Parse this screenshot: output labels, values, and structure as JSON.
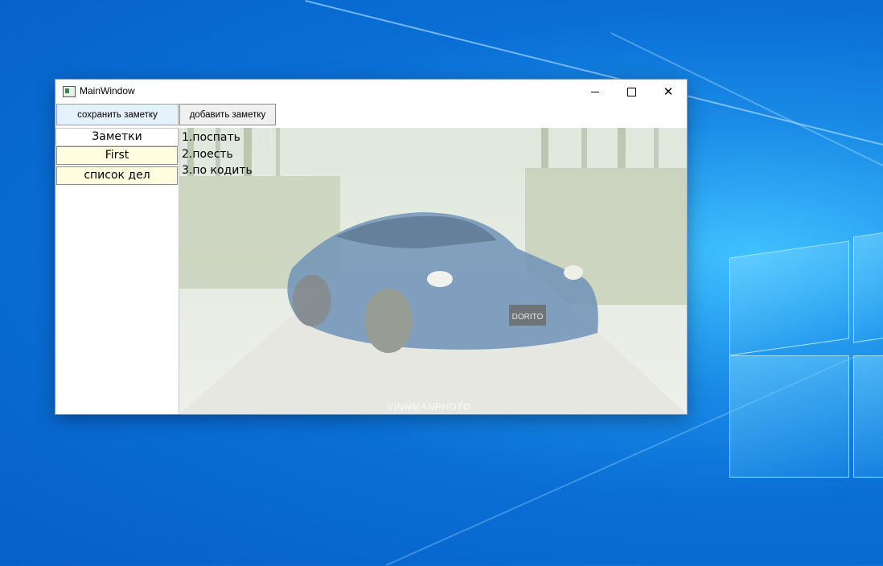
{
  "window": {
    "title": "MainWindow",
    "controls": {
      "minimize": "minimize",
      "maximize": "maximize",
      "close": "close"
    }
  },
  "toolbar": {
    "save_label": "сохранить заметку",
    "add_label": "добавить заметку"
  },
  "sidebar": {
    "header": "Заметки",
    "items": [
      {
        "label": "First"
      },
      {
        "label": "список дел"
      }
    ]
  },
  "note": {
    "lines": [
      "1.поспать",
      "2.поесть",
      "3.по кодить"
    ],
    "background_image": "car-photo",
    "plate_text": "DORITO",
    "watermark": "VINHMANPHOTO"
  },
  "colors": {
    "item_background": "#fffde0",
    "save_button_background": "#e5f1fb",
    "desktop_blue": "#0a6fd6"
  }
}
